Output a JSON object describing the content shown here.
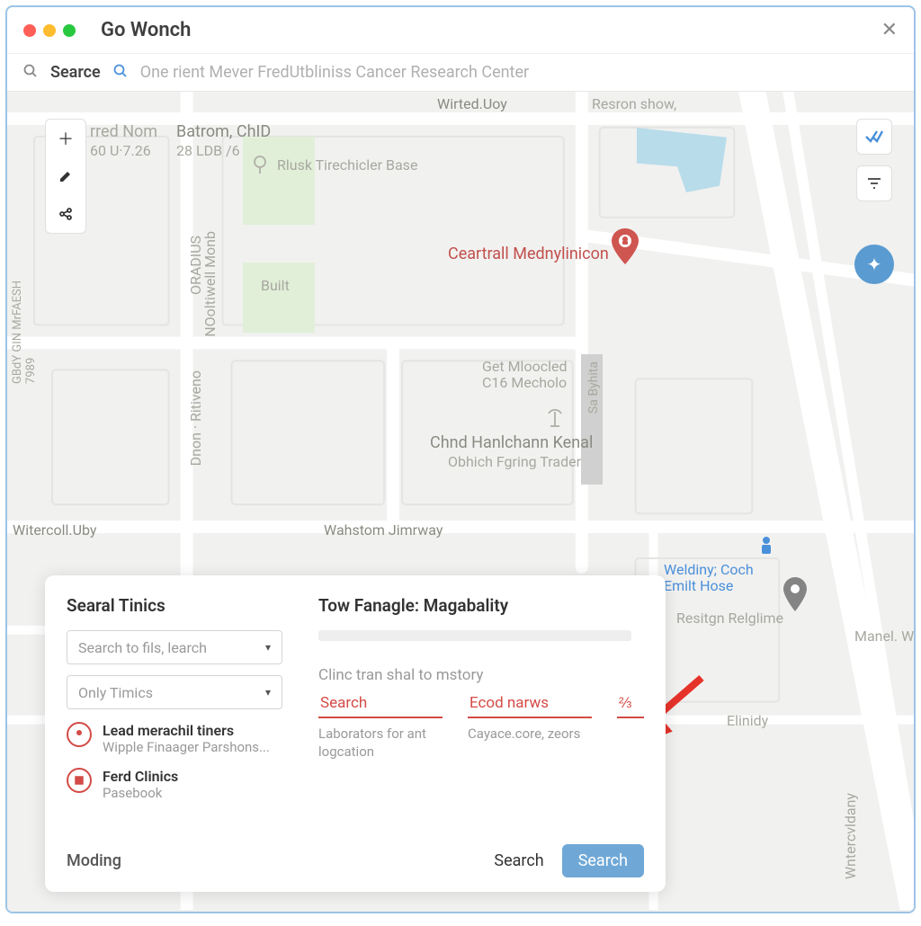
{
  "window": {
    "title": "Go Wonch"
  },
  "searchbar": {
    "label": "Searce",
    "placeholder": "One rient Mever FredUtbliniss Cancer Research Center"
  },
  "controls": {
    "left": [
      "plus",
      "edit",
      "share"
    ],
    "right": [
      "check",
      "filter",
      "add"
    ]
  },
  "map_labels": {
    "top_left_name": "rred Nom",
    "top_left_coord": "60 U·7.26",
    "batrom": "Batrom, ChID",
    "batrom_sub": "28 LDB /6",
    "rlusk": "Rlusk Tirechicler Base",
    "wirted": "Wirted.Uoy",
    "resron": "Resron show,",
    "ceartrall": "Ceartrall Mednylinicon",
    "built": "Built",
    "get_mloocled": "Get Mloocled",
    "get_mloocled2": "C16 Mecholo",
    "chna": "Chnd Hanlchann Kenal",
    "chna_sub": "Obhich Fgring Trader",
    "wanstorm": "Wahstom Jimrway",
    "witercoll": "Witercoll.Uby",
    "weldiny": "Weldiny; Coch",
    "emilt": "Emilt Hose",
    "resitgn": "Resitgn Relglime",
    "dnon": "Dnon · Ritiveno",
    "noormel": "NOoltiwell Monb",
    "oradius": "ORADIUS",
    "sa_byna": "Sa Byhita",
    "elinidy": "Elinidy",
    "manel": "Manel. W",
    "gbay": "GBdY GIN MrFAESH\n7989",
    "watercul": "Wntercvldany"
  },
  "panel": {
    "left_title": "Searal Tinics",
    "select1_placeholder": "Search to fils, learch",
    "select2_placeholder": "Only Timics",
    "clinics": [
      {
        "title": "Lead merachil tiners",
        "sub": "Wipple Finaager Parshons..."
      },
      {
        "title": "Ferd Clinics",
        "sub": "Pasebook"
      }
    ],
    "right_title": "Tow Fanagle: Magabality",
    "history_label": "Clinc tran shal to mstory",
    "field1_value": "Search",
    "field1_helper": "Laborators for ant logcation",
    "field2_value": "Ecod narws",
    "field2_helper": "Cayace.core, zeors",
    "footer_label": "Moding",
    "footer_action_plain": "Search",
    "footer_action_primary": "Search"
  }
}
